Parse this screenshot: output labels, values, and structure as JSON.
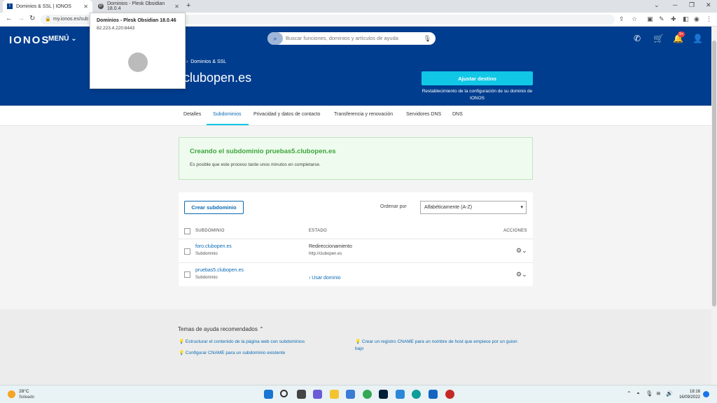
{
  "browser": {
    "tabs": [
      {
        "title": "Dominios & SSL | IONOS",
        "favicon": "I"
      },
      {
        "title": "Dominios - Plesk Obsidian 18.0.4",
        "favicon": "P"
      }
    ],
    "url": "my.ionos.es/sub"
  },
  "tooltip": {
    "title": "Dominios - Plesk Obsidian 18.0.46",
    "ip": "82.223.4.220:8443"
  },
  "header": {
    "logo": "IONOS",
    "menu": "MENÚ",
    "search_placeholder": "Buscar funciones, dominios y artículos de ayuda",
    "notification_badge": "9+",
    "breadcrumb": "Dominios & SSL",
    "domain": "clubopen.es",
    "ajustar_button": "Ajustar destino",
    "restablecer_text": "Restablecimiento de la configuración de su dominio de IONOS"
  },
  "subnav": {
    "items": [
      "Detalles",
      "Subdominios",
      "Privacidad y datos de contacto",
      "Transferencia y renovación",
      "Servidores DNS",
      "DNS"
    ],
    "active": "Subdominios"
  },
  "notice": {
    "title": "Creando el subdominio pruebas5.clubopen.es",
    "text": "Es posible que este proceso tarde unos minutos en completarse."
  },
  "panel": {
    "create_button": "Crear subdominio",
    "sort_label": "Ordenar por",
    "sort_value": "Alfabéticamente (A-Z)",
    "columns": [
      "SUBDOMINIO",
      "ESTADO",
      "ACCIONES"
    ],
    "rows": [
      {
        "name": "foro.clubopen.es",
        "type": "Subdominio",
        "status": "Redireccionamiento",
        "target": "http://clubopen.es"
      },
      {
        "name": "pruebas5.clubopen.es",
        "type": "Subdominio",
        "status": "",
        "target": "Usar dominio"
      }
    ]
  },
  "help": {
    "title": "Temas de ayuda recomendados",
    "links": [
      "Estructurar el contenido de la página web con subdominios",
      "Configurar CNAME para un subdominio existente",
      "Crear un registro CNAME para un nombre de host que empiece por un guion bajo"
    ]
  },
  "taskbar": {
    "temp": "28°C",
    "weather": "Soleado",
    "time": "18:16",
    "date": "16/09/2022"
  },
  "colors": {
    "brand": "#003d8f",
    "accent": "#11c7e6",
    "success": "#3ca53c",
    "link": "#0b6ab3"
  }
}
